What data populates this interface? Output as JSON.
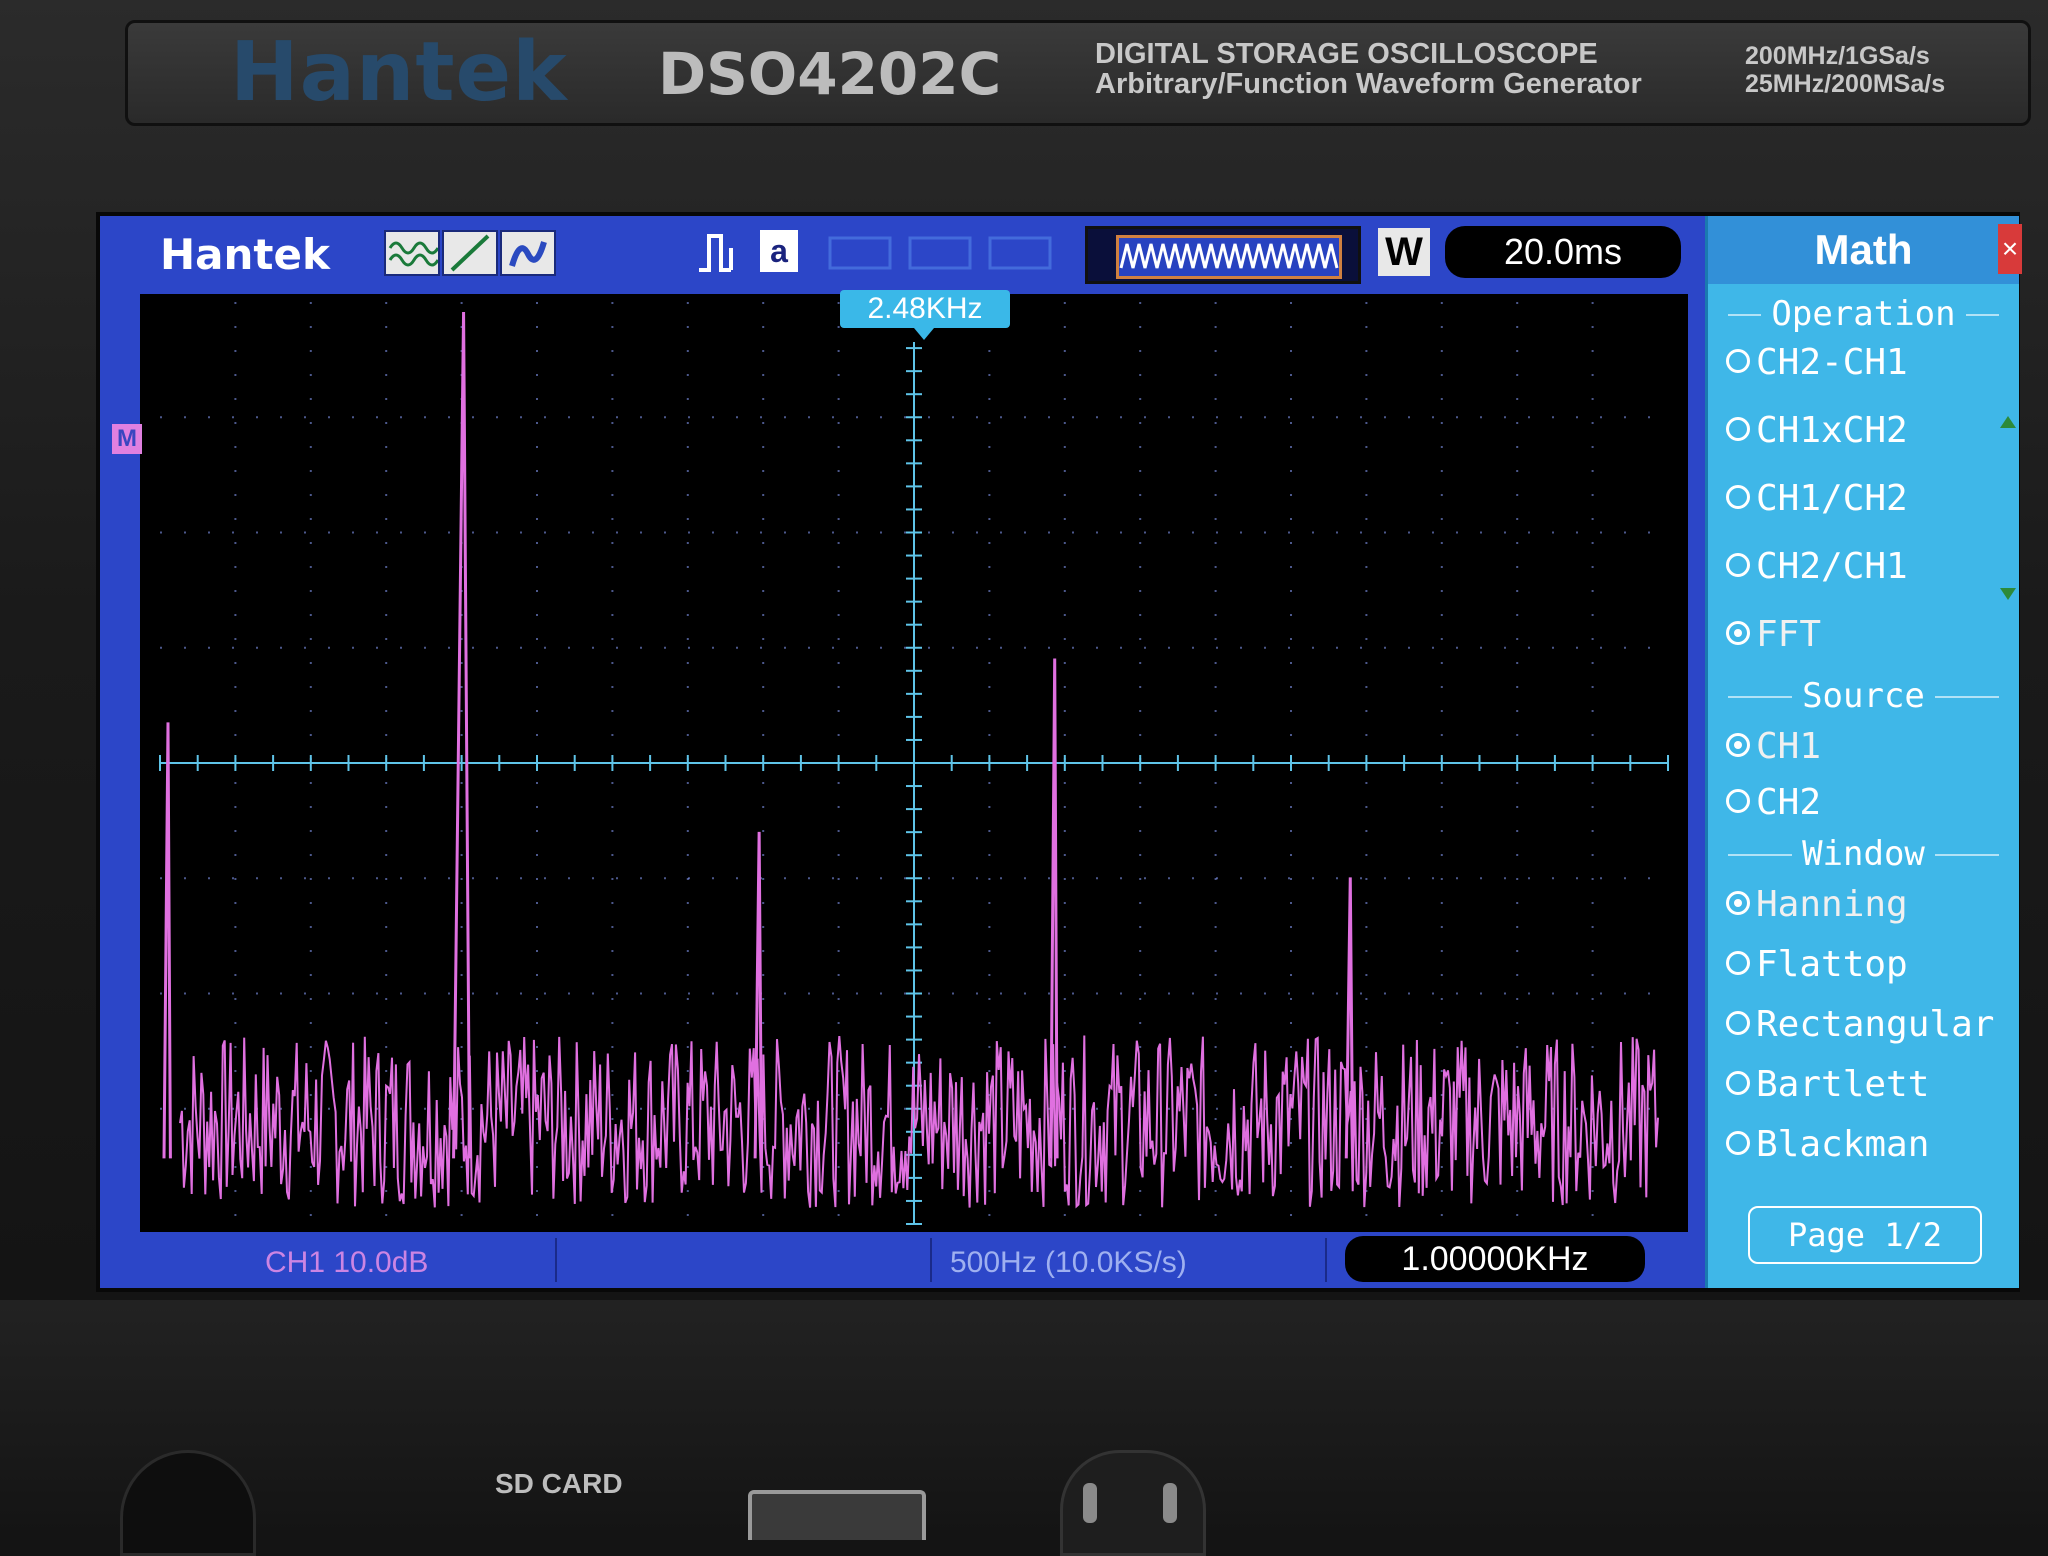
{
  "device": {
    "brand": "Hantek",
    "model": "DSO4202C",
    "description_line1": "DIGITAL STORAGE OSCILLOSCOPE",
    "description_line2": "Arbitrary/Function Waveform Generator",
    "spec_line1": "200MHz/1GSa/s",
    "spec_line2": "25MHz/200MSa/s"
  },
  "screen": {
    "logo": "Hantek",
    "acquire_mode": "a",
    "window_label": "W",
    "timebase": "20.0ms",
    "cursor_freq": "2.48KHz",
    "marker": "M",
    "status": {
      "ch1_scale": "CH1 10.0dB",
      "sample_rate": "500Hz (10.0KS/s)",
      "measured_freq": "1.00000KHz"
    }
  },
  "menu": {
    "title": "Math",
    "sections": [
      {
        "heading": "Operation",
        "options": [
          {
            "label": "CH2-CH1",
            "selected": false
          },
          {
            "label": "CH1xCH2",
            "selected": false
          },
          {
            "label": "CH1/CH2",
            "selected": false
          },
          {
            "label": "CH2/CH1",
            "selected": false
          },
          {
            "label": "FFT",
            "selected": true
          }
        ]
      },
      {
        "heading": "Source",
        "options": [
          {
            "label": "CH1",
            "selected": true
          },
          {
            "label": "CH2",
            "selected": false
          }
        ]
      },
      {
        "heading": "Window",
        "options": [
          {
            "label": "Hanning",
            "selected": true
          },
          {
            "label": "Flattop",
            "selected": false
          },
          {
            "label": "Rectangular",
            "selected": false
          },
          {
            "label": "Bartlett",
            "selected": false
          },
          {
            "label": "Blackman",
            "selected": false
          }
        ]
      }
    ],
    "page": "Page 1/2"
  },
  "panel": {
    "sd_card_label": "SD CARD"
  },
  "chart_data": {
    "type": "line",
    "title": "",
    "xlabel": "",
    "ylabel": "",
    "x_unit": "Hz",
    "y_unit": "dB",
    "grid": true,
    "x_divisions": 20,
    "y_divisions": 8,
    "series": [
      {
        "color": "#e070e0",
        "peaks": [
          {
            "x": 0,
            "y": 0.55
          },
          {
            "x": 1000,
            "y": 1.0
          },
          {
            "x": 2000,
            "y": 0.43
          },
          {
            "x": 3000,
            "y": 0.62
          },
          {
            "x": 4000,
            "y": 0.38
          }
        ],
        "noise_floor": 0.18
      }
    ]
  },
  "colors": {
    "screen_bg": "#2c46c8",
    "trace": "#e070e0",
    "grid_axis": "#5fc4e8",
    "menu_bg": "#3fb7e8"
  }
}
